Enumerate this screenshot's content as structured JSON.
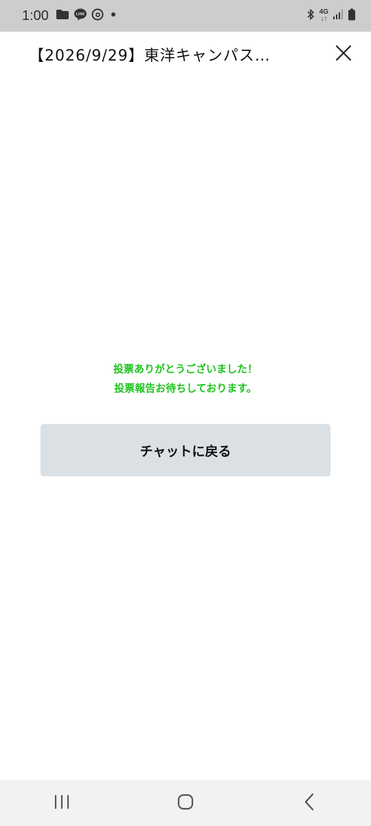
{
  "status_bar": {
    "time": "1:00",
    "network_type_top": "4G",
    "network_type_bottom": "↓↑"
  },
  "header": {
    "title": "【2026/9/29】東洋キャンパス…"
  },
  "message": {
    "line1": "投票ありがとうございました！",
    "line2": "投票報告お待ちしております。",
    "color": "#1cc41c"
  },
  "back_button": {
    "label": "チャットに戻る",
    "background": "#dae0e4"
  },
  "icons": {
    "status_left": [
      "folder-icon",
      "line-app-icon",
      "threads-icon",
      "dot-icon"
    ],
    "status_right": [
      "bluetooth-icon",
      "signal-icon",
      "battery-icon"
    ],
    "header": [
      "close-icon"
    ],
    "nav": [
      "recent-apps-icon",
      "home-icon",
      "back-icon"
    ]
  }
}
